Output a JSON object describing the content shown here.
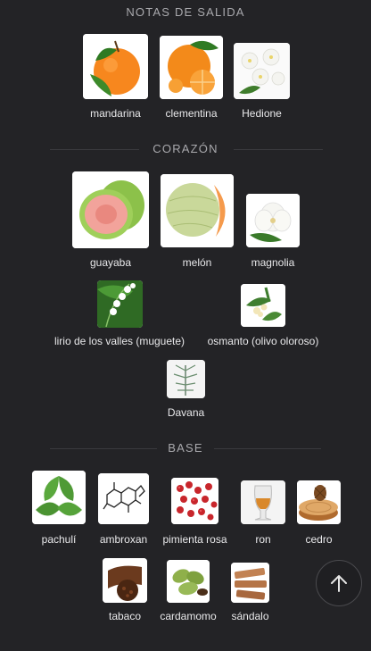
{
  "sections": {
    "top": {
      "title": "NOTAS DE SALIDA"
    },
    "heart": {
      "title": "CORAZÓN"
    },
    "base": {
      "title": "BASE"
    }
  },
  "notes": {
    "mandarina": "mandarina",
    "clementina": "clementina",
    "hedione": "Hedione",
    "guayaba": "guayaba",
    "melon": "melón",
    "magnolia": "magnolia",
    "lirio": "lirio de los valles (muguete)",
    "osmanto": "osmanto (olivo oloroso)",
    "davana": "Davana",
    "pachuli": "pachulí",
    "ambroxan": "ambroxan",
    "pimienta": "pimienta rosa",
    "ron": "ron",
    "cedro": "cedro",
    "tabaco": "tabaco",
    "cardamomo": "cardamomo",
    "sandalo": "sándalo"
  },
  "icons": {
    "scroll_top": "arrow-up-icon"
  }
}
